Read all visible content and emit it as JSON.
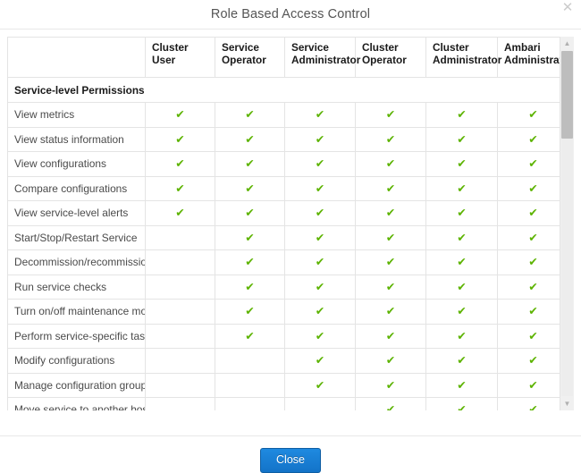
{
  "dialog": {
    "title": "Role Based Access Control",
    "close_icon": "close-icon",
    "close_button_label": "Close"
  },
  "table": {
    "row_header_label": "",
    "columns": [
      "Cluster User",
      "Service Operator",
      "Service Administrator",
      "Cluster Operator",
      "Cluster Administrator",
      "Ambari Administrator"
    ],
    "sections": [
      {
        "title": "Service-level Permissions",
        "rows": [
          {
            "label": "View metrics",
            "checks": [
              true,
              true,
              true,
              true,
              true,
              true
            ]
          },
          {
            "label": "View status information",
            "checks": [
              true,
              true,
              true,
              true,
              true,
              true
            ]
          },
          {
            "label": "View configurations",
            "checks": [
              true,
              true,
              true,
              true,
              true,
              true
            ]
          },
          {
            "label": "Compare configurations",
            "checks": [
              true,
              true,
              true,
              true,
              true,
              true
            ]
          },
          {
            "label": "View service-level alerts",
            "checks": [
              true,
              true,
              true,
              true,
              true,
              true
            ]
          },
          {
            "label": "Start/Stop/Restart Service",
            "checks": [
              false,
              true,
              true,
              true,
              true,
              true
            ]
          },
          {
            "label": "Decommission/recommission",
            "checks": [
              false,
              true,
              true,
              true,
              true,
              true
            ]
          },
          {
            "label": "Run service checks",
            "checks": [
              false,
              true,
              true,
              true,
              true,
              true
            ]
          },
          {
            "label": "Turn on/off maintenance mode",
            "checks": [
              false,
              true,
              true,
              true,
              true,
              true
            ]
          },
          {
            "label": "Perform service-specific tasks",
            "checks": [
              false,
              true,
              true,
              true,
              true,
              true
            ]
          },
          {
            "label": "Modify configurations",
            "checks": [
              false,
              false,
              true,
              true,
              true,
              true
            ]
          },
          {
            "label": "Manage configuration groups",
            "checks": [
              false,
              false,
              true,
              true,
              true,
              true
            ]
          },
          {
            "label": "Move service to another host",
            "checks": [
              false,
              false,
              false,
              true,
              true,
              true
            ]
          }
        ]
      }
    ],
    "check_glyph": "✔",
    "check_color": "#5cb300"
  },
  "scrollbar": {
    "up_arrow_icon": "chevron-up-icon",
    "down_arrow_icon": "chevron-down-icon",
    "thumb_position_percent": 0,
    "thumb_size_percent": 25
  }
}
